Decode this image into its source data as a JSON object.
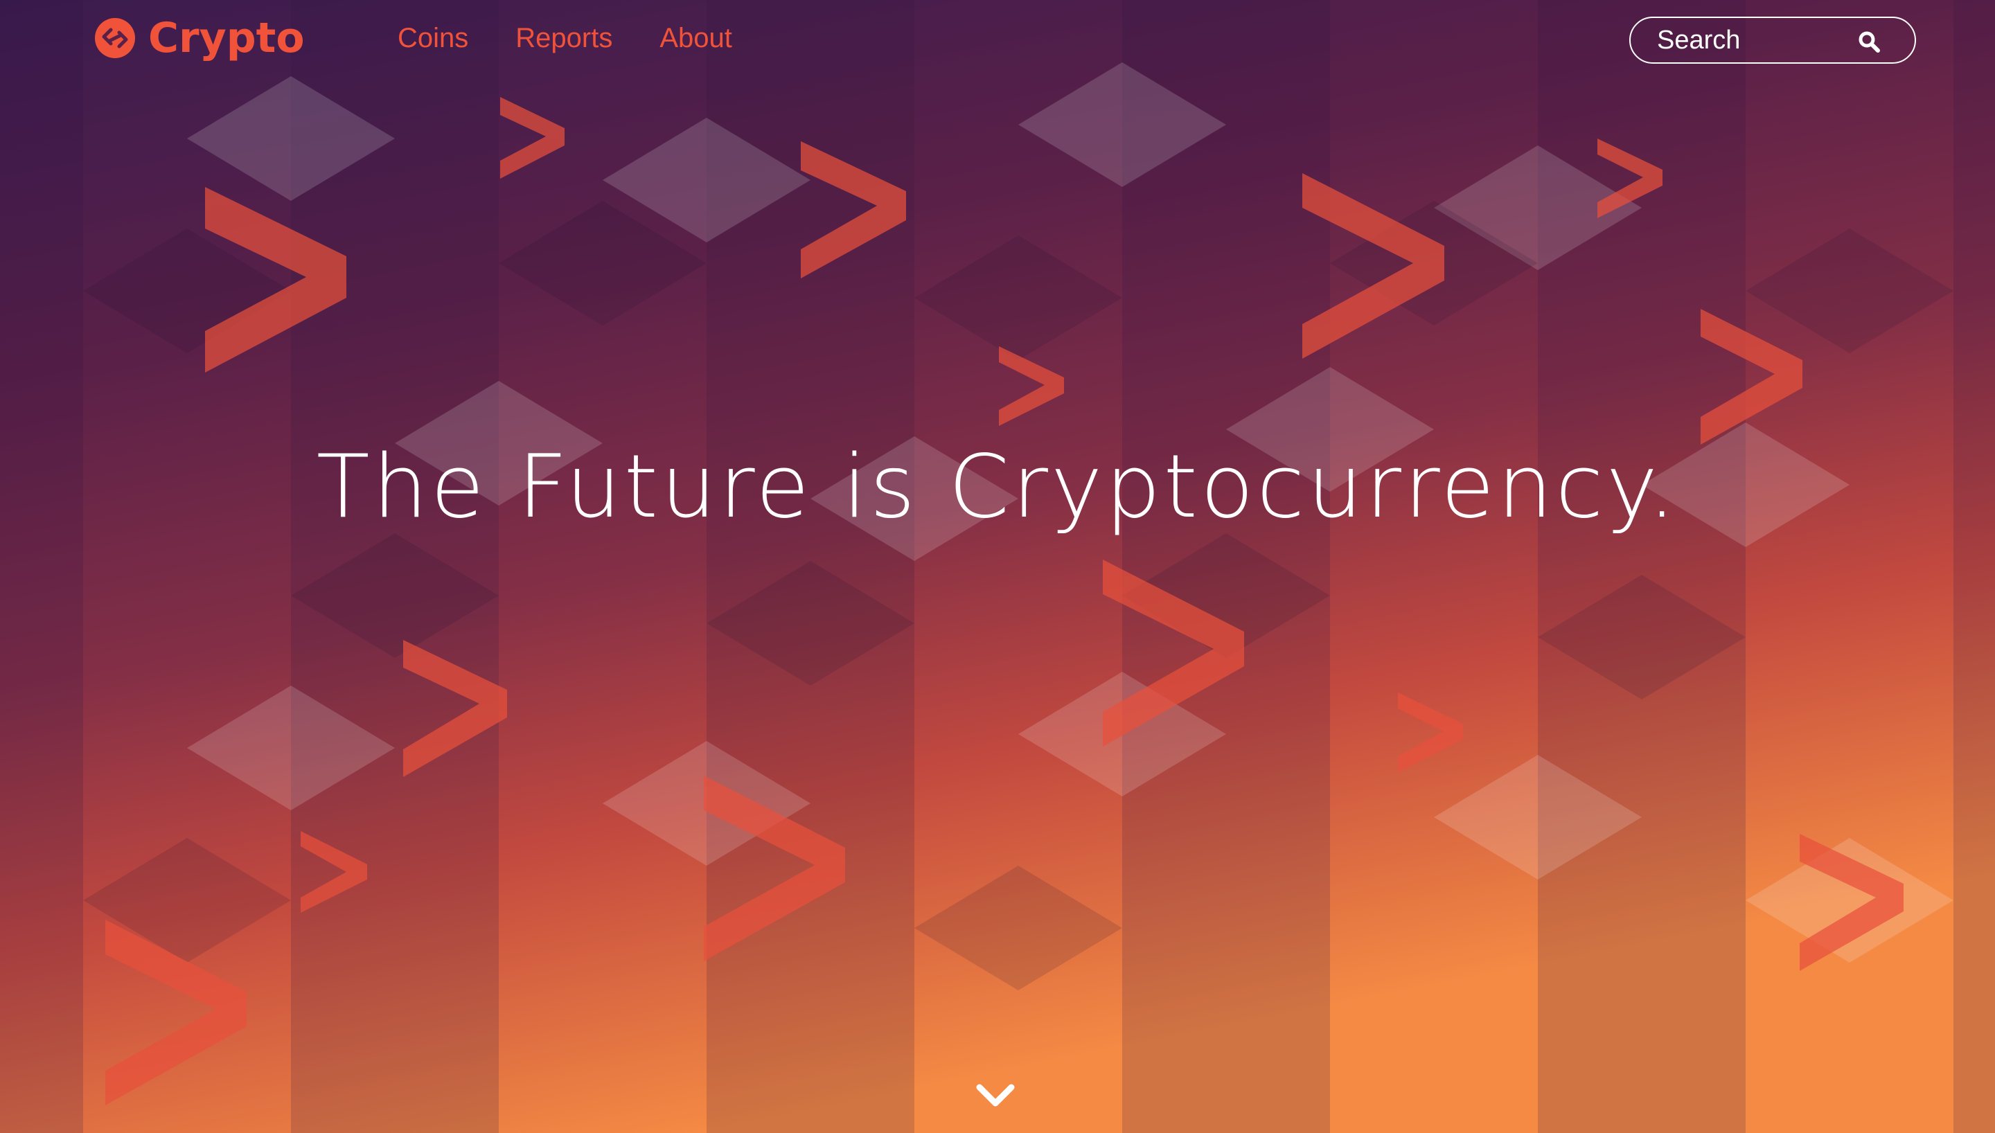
{
  "brand": {
    "name": "Crypto",
    "accent_color": "#f0533a"
  },
  "nav": {
    "items": [
      {
        "label": "Coins"
      },
      {
        "label": "Reports"
      },
      {
        "label": "About"
      }
    ]
  },
  "search": {
    "placeholder": "Search",
    "icon": "search-icon"
  },
  "hero": {
    "headline": "The Future is Cryptocurrency.",
    "scroll_icon": "chevron-down-icon"
  }
}
